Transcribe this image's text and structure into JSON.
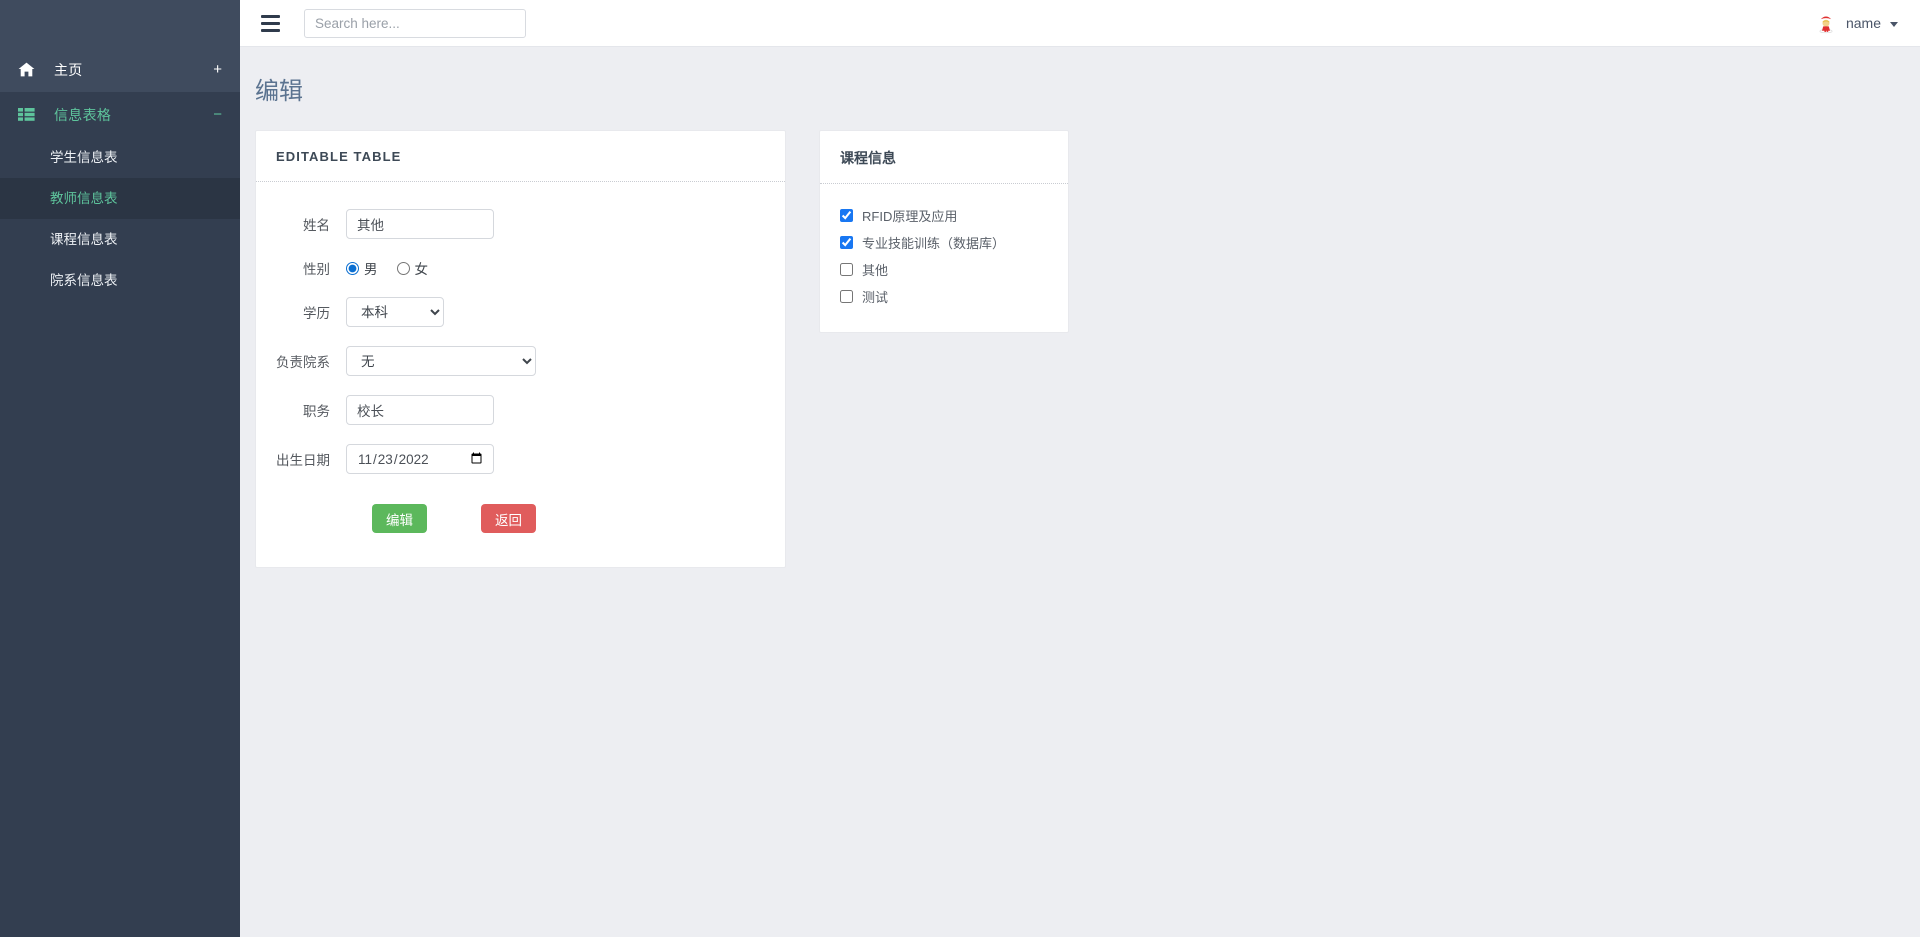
{
  "sidebar": {
    "groups": [
      {
        "label": "主页",
        "icon": "home-icon",
        "toggle": "+",
        "state": "collapsed"
      },
      {
        "label": "信息表格",
        "icon": "table-list-icon",
        "toggle": "−",
        "state": "expanded"
      }
    ],
    "sub_items": [
      {
        "label": "学生信息表",
        "active": false
      },
      {
        "label": "教师信息表",
        "active": true
      },
      {
        "label": "课程信息表",
        "active": false
      },
      {
        "label": "院系信息表",
        "active": false
      }
    ],
    "colors": {
      "background": "#333e50",
      "active_background": "#2b3544",
      "accent": "#5ec49c"
    }
  },
  "header": {
    "menu_icon": "hamburger-icon",
    "search": {
      "placeholder": "Search here...",
      "value": ""
    },
    "user": {
      "name": "name",
      "avatar_icon": "avatar-icon",
      "caret_icon": "chevron-down-icon"
    }
  },
  "main": {
    "page_title": "编辑",
    "editable_card": {
      "title": "EDITABLE TABLE",
      "fields": {
        "name": {
          "label": "姓名",
          "value": "其他"
        },
        "gender": {
          "label": "性别",
          "options": [
            {
              "label": "男",
              "checked": true
            },
            {
              "label": "女",
              "checked": false
            }
          ]
        },
        "education": {
          "label": "学历",
          "value": "本科",
          "options": [
            "本科"
          ]
        },
        "department": {
          "label": "负责院系",
          "value": "无",
          "options": [
            "无"
          ]
        },
        "position": {
          "label": "职务",
          "value": "校长"
        },
        "birthdate": {
          "label": "出生日期",
          "value": "2022-11-23",
          "display": "2022/11/23"
        }
      },
      "buttons": {
        "submit": {
          "label": "编辑",
          "color": "#5cb85c"
        },
        "back": {
          "label": "返回",
          "color": "#e05c5c"
        }
      }
    },
    "course_card": {
      "title": "课程信息",
      "items": [
        {
          "label": "RFID原理及应用",
          "checked": true
        },
        {
          "label": "专业技能训练（数据库）",
          "checked": true
        },
        {
          "label": "其他",
          "checked": false
        },
        {
          "label": "测试",
          "checked": false
        }
      ]
    }
  }
}
